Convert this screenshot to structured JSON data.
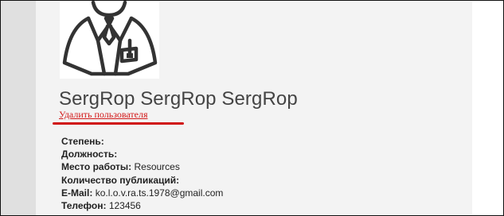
{
  "profile": {
    "name": "SergRop SergRop SergRop",
    "delete_link": "Удалить пользователя",
    "details": [
      {
        "label": "Степень:",
        "value": ""
      },
      {
        "label": "Должность:",
        "value": ""
      },
      {
        "label": "Место работы:",
        "value": "Resources"
      },
      {
        "label": "Количество публикаций:",
        "value": ""
      },
      {
        "label": "E-Mail:",
        "value": "ko.l.o.v.ra.ts.1978@gmail.com"
      },
      {
        "label": "Телефон:",
        "value": "123456"
      }
    ]
  },
  "colors": {
    "delete_link": "#d21818",
    "highlight_underline": "#d01010",
    "panel_background": "#f3f3f3",
    "left_stripe": "#e0e0e0"
  },
  "icons": {
    "avatar": "user-avatar-icon"
  }
}
